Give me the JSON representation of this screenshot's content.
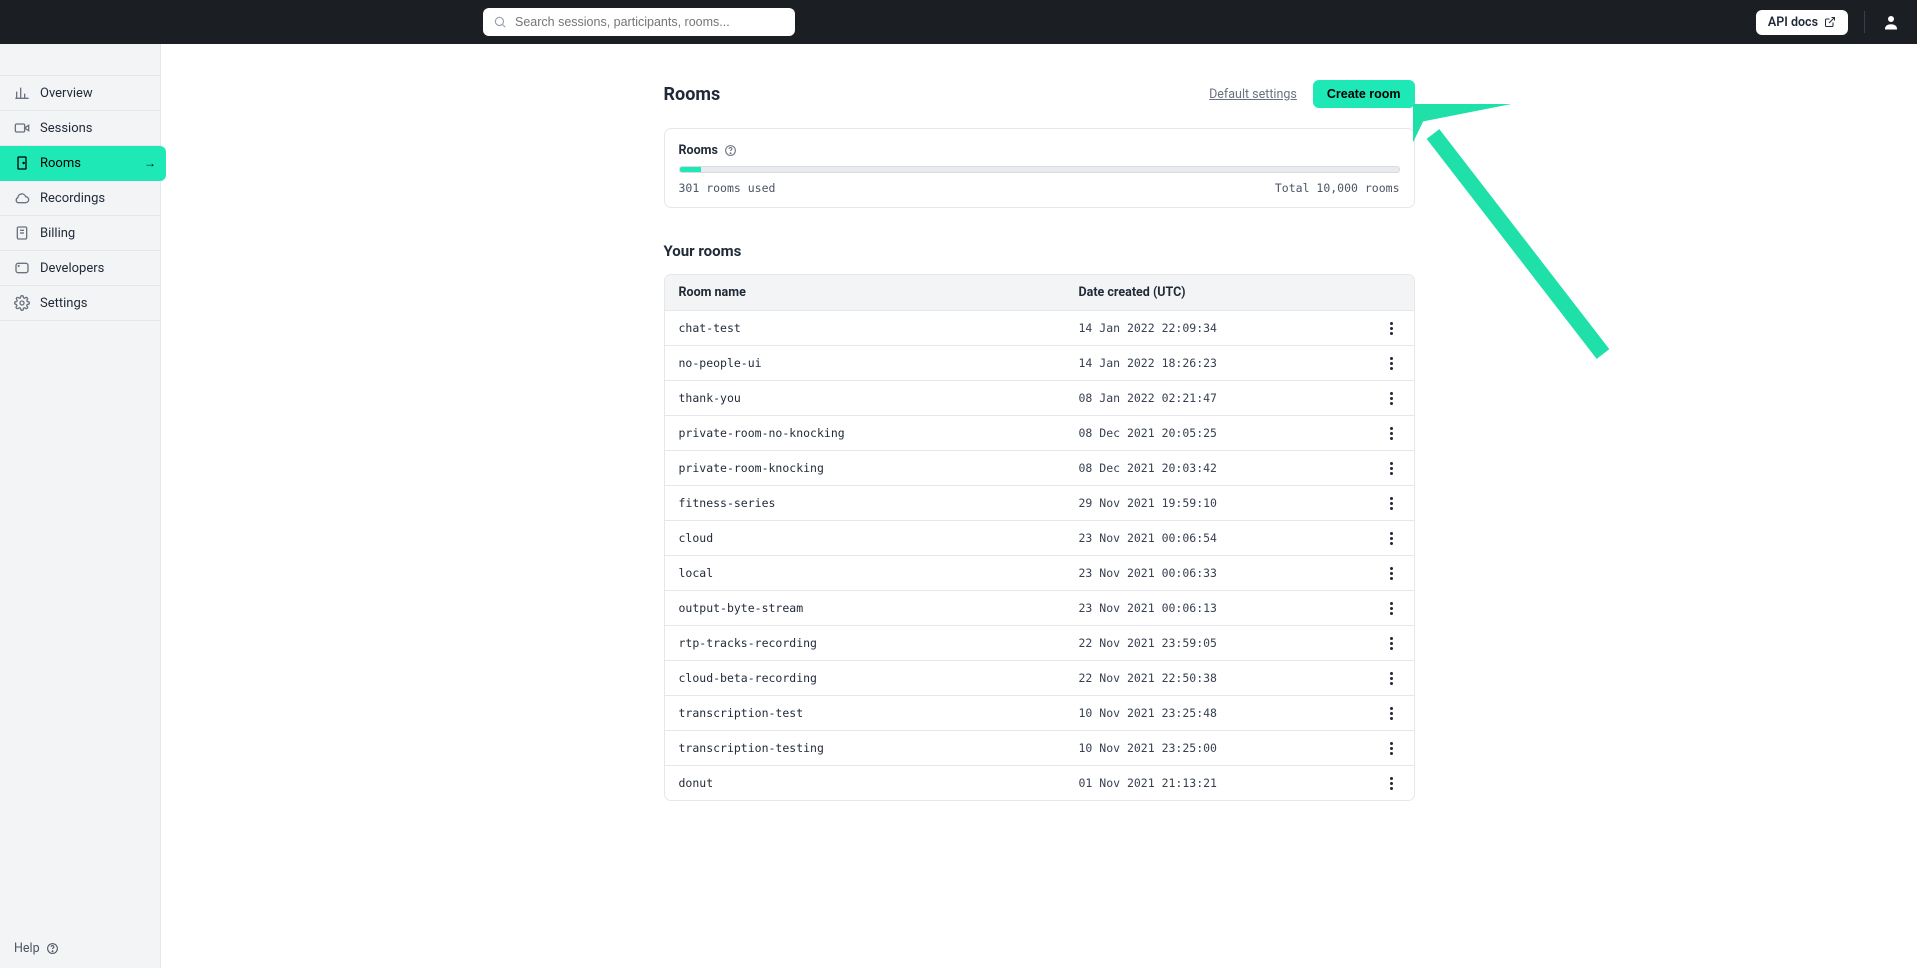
{
  "header": {
    "search_placeholder": "Search sessions, participants, rooms...",
    "api_docs_label": "API docs"
  },
  "sidebar": {
    "items": [
      {
        "label": "Overview",
        "icon": "bar-chart-icon"
      },
      {
        "label": "Sessions",
        "icon": "video-icon"
      },
      {
        "label": "Rooms",
        "icon": "door-icon"
      },
      {
        "label": "Recordings",
        "icon": "cloud-icon"
      },
      {
        "label": "Billing",
        "icon": "receipt-icon"
      },
      {
        "label": "Developers",
        "icon": "window-icon"
      },
      {
        "label": "Settings",
        "icon": "gear-icon"
      }
    ],
    "help_label": "Help"
  },
  "page": {
    "title": "Rooms",
    "default_settings_label": "Default settings",
    "create_room_label": "Create room",
    "usage_card": {
      "title": "Rooms",
      "used_label": "301 rooms used",
      "total_label": "Total 10,000 rooms",
      "percent": 3.01
    },
    "your_rooms_title": "Your rooms",
    "columns": {
      "name": "Room name",
      "date": "Date created (UTC)"
    },
    "rooms": [
      {
        "name": "chat-test",
        "date": "14 Jan 2022 22:09:34"
      },
      {
        "name": "no-people-ui",
        "date": "14 Jan 2022 18:26:23"
      },
      {
        "name": "thank-you",
        "date": "08 Jan 2022 02:21:47"
      },
      {
        "name": "private-room-no-knocking",
        "date": "08 Dec 2021 20:05:25"
      },
      {
        "name": "private-room-knocking",
        "date": "08 Dec 2021 20:03:42"
      },
      {
        "name": "fitness-series",
        "date": "29 Nov 2021 19:59:10"
      },
      {
        "name": "cloud",
        "date": "23 Nov 2021 00:06:54"
      },
      {
        "name": "local",
        "date": "23 Nov 2021 00:06:33"
      },
      {
        "name": "output-byte-stream",
        "date": "23 Nov 2021 00:06:13"
      },
      {
        "name": "rtp-tracks-recording",
        "date": "22 Nov 2021 23:59:05"
      },
      {
        "name": "cloud-beta-recording",
        "date": "22 Nov 2021 22:50:38"
      },
      {
        "name": "transcription-test",
        "date": "10 Nov 2021 23:25:48"
      },
      {
        "name": "transcription-testing",
        "date": "10 Nov 2021 23:25:00"
      },
      {
        "name": "donut",
        "date": "01 Nov 2021 21:13:21"
      }
    ]
  }
}
